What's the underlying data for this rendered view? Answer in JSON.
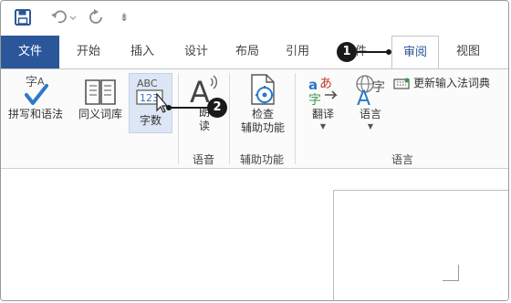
{
  "quick_access": {
    "save_icon": "save-icon",
    "undo_icon": "undo-icon",
    "redo_icon": "redo-icon",
    "customize_glyph": "⇟"
  },
  "tabs": {
    "file": "文件",
    "home": "开始",
    "insert": "插入",
    "design": "设计",
    "layout": "布局",
    "references": "引用",
    "mailings": "邮件",
    "review": "审阅",
    "view": "视图"
  },
  "ribbon": {
    "spelling_grammar": "拼写和语法",
    "thesaurus": "同义词库",
    "word_count": "字数",
    "read_aloud_line1": "朗",
    "read_aloud_line2": "读",
    "check_accessibility_line1": "检查",
    "check_accessibility_line2": "辅助功能",
    "translate": "翻译",
    "language": "语言",
    "ime_dictionary": "更新输入法词典",
    "group_speech": "语音",
    "group_accessibility": "辅助功能",
    "group_language": "语言"
  },
  "callouts": {
    "step1": "1",
    "step2": "2"
  },
  "colors": {
    "accent": "#2b579a",
    "selected_button_bg": "#dce6f4",
    "callout": "#1a1a1a"
  }
}
